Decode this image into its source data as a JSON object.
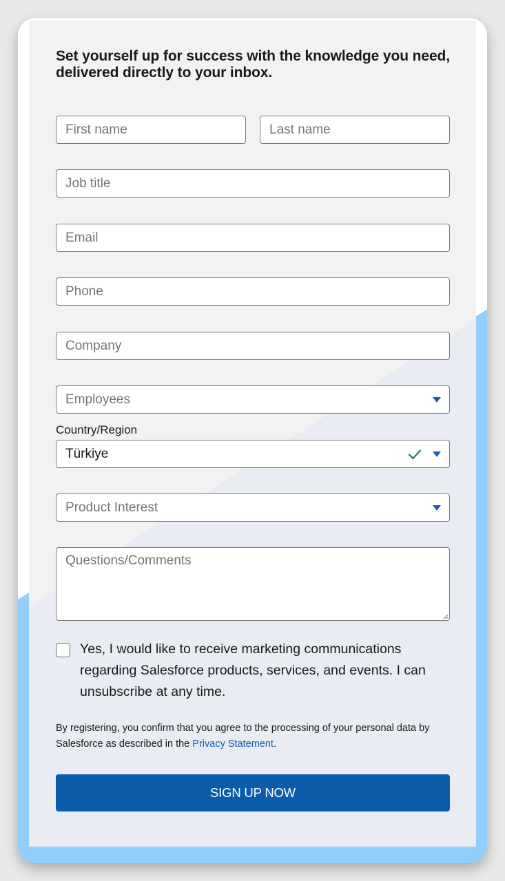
{
  "form": {
    "headline": "Set yourself up for success with the knowledge you need, delivered directly to your inbox.",
    "fields": {
      "first_name": {
        "placeholder": "First name",
        "value": ""
      },
      "last_name": {
        "placeholder": "Last name",
        "value": ""
      },
      "job_title": {
        "placeholder": "Job title",
        "value": ""
      },
      "email": {
        "placeholder": "Email",
        "value": ""
      },
      "phone": {
        "placeholder": "Phone",
        "value": ""
      },
      "company": {
        "placeholder": "Company",
        "value": ""
      },
      "employees": {
        "placeholder": "Employees",
        "icon": "chevron-down-icon"
      },
      "country": {
        "label": "Country/Region",
        "value": "Türkiye",
        "valid_icon": "check-icon",
        "icon": "chevron-down-icon"
      },
      "product_interest": {
        "placeholder": "Product Interest",
        "icon": "chevron-down-icon"
      },
      "comments": {
        "placeholder": "Questions/Comments",
        "value": ""
      }
    },
    "consent": {
      "checked": false,
      "text": "Yes, I would like to receive marketing communications regarding Salesforce products, services, and events.  I can unsubscribe at any time."
    },
    "legal": {
      "text_before": "By registering, you confirm that you agree to the processing of your personal data by Salesforce as described in the ",
      "link_text": "Privacy Statement",
      "text_after": "."
    },
    "submit_label": "SIGN UP NOW"
  },
  "colors": {
    "accent": "#0d5cab",
    "link": "#0b5cab",
    "caret": "#1b5fa8",
    "valid_check": "#2e844a",
    "card_blue": "#90cffb",
    "page_bg": "#e8e8e8"
  }
}
